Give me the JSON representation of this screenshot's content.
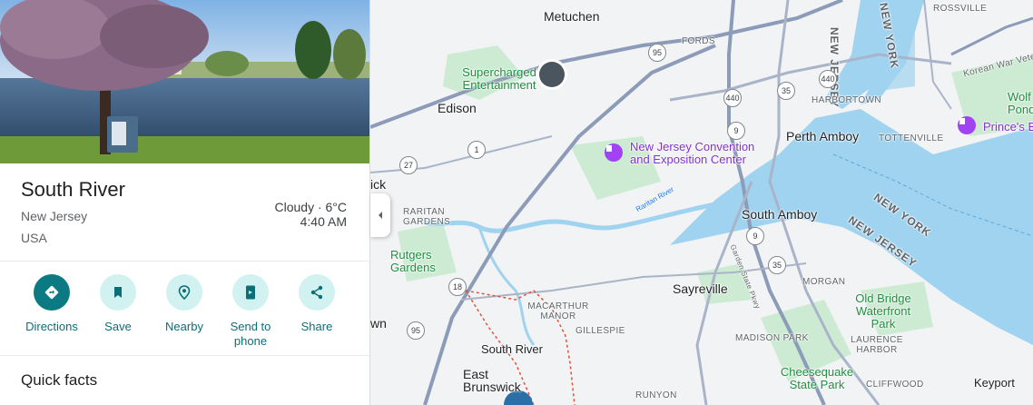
{
  "place": {
    "title": "South River",
    "region": "New Jersey",
    "country": "USA",
    "weather": "Cloudy · 6°C",
    "time": "4:40 AM"
  },
  "actions": [
    {
      "label": "Directions",
      "icon": "directions-icon"
    },
    {
      "label": "Save",
      "icon": "bookmark-icon"
    },
    {
      "label": "Nearby",
      "icon": "nearby-icon"
    },
    {
      "label": "Send to phone",
      "icon": "send-to-phone-icon"
    },
    {
      "label": "Share",
      "icon": "share-icon"
    }
  ],
  "quick_facts": "Quick facts",
  "map": {
    "labels": {
      "metuchen": "Metuchen",
      "fords": "FORDS",
      "new_jersey_top": "NEW JERSEY",
      "new_york_top": "NEW YORK",
      "rossville": "ROSSVILLE",
      "korean_war_veterans": "Korean War Veterans",
      "supercharged": "Supercharged Entertainment",
      "edison": "Edison",
      "harbortown": "HARBORTOWN",
      "wolfe_pond": "Wolf Pond",
      "princes_bay": "Prince's B",
      "perth_amboy": "Perth Amboy",
      "tottenville": "TOTTENVILLE",
      "nj_convention": "New Jersey Convention and Exposition Center",
      "ick": "ick",
      "raritan_gardens": "RARITAN GARDENS",
      "raritan_river": "Raritan River",
      "south_amboy": "South Amboy",
      "new_york_mid": "NEW YORK",
      "new_jersey_mid": "NEW JERSEY",
      "rutgers_gardens": "Rutgers Gardens",
      "garden_state_pkwy": "Garden State Pkwy",
      "sayreville": "Sayreville",
      "morgan": "MORGAN",
      "old_bridge": "Old Bridge Waterfront Park",
      "wn": "wn",
      "macarthur_manor": "MACARTHUR MANOR",
      "gillespie": "GILLESPIE",
      "south_river": "South River",
      "madison_park": "MADISON PARK",
      "laurence_harbor": "LAURENCE HARBOR",
      "east_brunswick": "East Brunswick",
      "cheesequake": "Cheesequake State Park",
      "cliffwood": "CLIFFWOOD",
      "keyport": "Keyport",
      "runyon": "RUNYON"
    },
    "shields": {
      "i95_top": "95",
      "r440_a": "440",
      "r440_b": "440",
      "r35_a": "35",
      "r9_a": "9",
      "r1": "1",
      "r27": "27",
      "r9_b": "9",
      "r35_b": "35",
      "r18": "18",
      "i95_bottom": "95"
    },
    "colors": {
      "water": "#9fd3f0",
      "park": "#cdebd3",
      "road": "#aab4c8",
      "highway": "#8c9bb8",
      "land": "#f1f3f4",
      "boundary": "#e0533a"
    }
  }
}
